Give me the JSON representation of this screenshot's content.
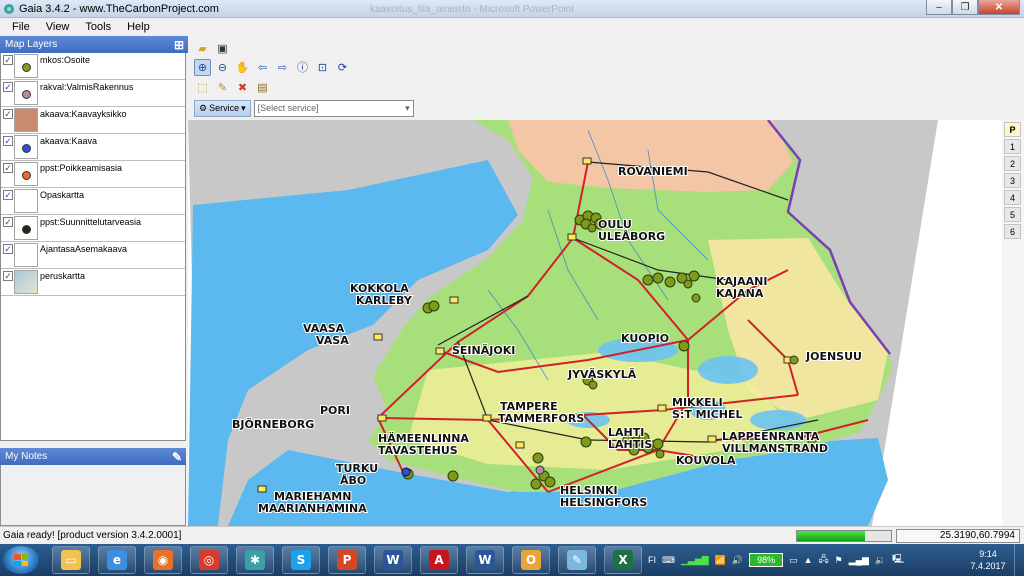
{
  "window": {
    "title": "Gaia 3.4.2 - www.TheCarbonProject.com",
    "background_title": "kaavoitus_tila_aineisto - Microsoft PowerPoint",
    "minimize": "–",
    "maximize": "❐",
    "close": "✕"
  },
  "menu": [
    "File",
    "View",
    "Tools",
    "Help"
  ],
  "map_layers": {
    "header": "Map Layers",
    "items": [
      {
        "label": "mkos:Osoite",
        "checked": true,
        "symbol": "dot",
        "color": "#8a9a1c"
      },
      {
        "label": "rakval:ValmisRakennus",
        "checked": true,
        "symbol": "dot",
        "color": "#b88aa0"
      },
      {
        "label": "akaava:Kaavayksikko",
        "checked": true,
        "symbol": "fill",
        "color": "#c98a72"
      },
      {
        "label": "akaava:Kaava",
        "checked": true,
        "symbol": "dot",
        "color": "#2f4fe0"
      },
      {
        "label": "ppst:Poikkeamisasia",
        "checked": true,
        "symbol": "dot",
        "color": "#e86a2c"
      },
      {
        "label": "Opaskartta",
        "checked": true,
        "symbol": "none",
        "color": "#ffffff"
      },
      {
        "label": "ppst:Suunnittelutarveasia",
        "checked": true,
        "symbol": "dot",
        "color": "#1e2a10"
      },
      {
        "label": "AjantasaAsemakaava",
        "checked": true,
        "symbol": "none",
        "color": "#ffffff"
      },
      {
        "label": "peruskartta",
        "checked": true,
        "symbol": "thumb",
        "color": "#a9c8de"
      }
    ]
  },
  "notes": {
    "header": "My Notes"
  },
  "toolbar": {
    "service_label": "Service",
    "service_placeholder": "[Select service]"
  },
  "map": {
    "places": [
      {
        "id": "rovaniemi",
        "text": "ROVANIEMI"
      },
      {
        "id": "oulu1",
        "text": "OULU"
      },
      {
        "id": "oulu2",
        "text": "ULEÅBORG"
      },
      {
        "id": "kajaani1",
        "text": "KAJAANI"
      },
      {
        "id": "kajaani2",
        "text": "KAJANA"
      },
      {
        "id": "kokkola1",
        "text": "KOKKOLA"
      },
      {
        "id": "kokkola2",
        "text": "KARLEBY"
      },
      {
        "id": "vaasa1",
        "text": "VAASA"
      },
      {
        "id": "vaasa2",
        "text": "VASA"
      },
      {
        "id": "seinajoki",
        "text": "SEINÄJOKI"
      },
      {
        "id": "kuopio",
        "text": "KUOPIO"
      },
      {
        "id": "joensuu",
        "text": "JOENSUU"
      },
      {
        "id": "jyvaskyla",
        "text": "JYVÄSKYLÄ"
      },
      {
        "id": "pori1",
        "text": "PORI"
      },
      {
        "id": "pori2",
        "text": "BJÖRNEBORG"
      },
      {
        "id": "tampere1",
        "text": "TAMPERE"
      },
      {
        "id": "tampere2",
        "text": "TAMMERFORS"
      },
      {
        "id": "mikkeli1",
        "text": "MIKKELI"
      },
      {
        "id": "mikkeli2",
        "text": "S:T MICHEL"
      },
      {
        "id": "hameenlinna1",
        "text": "HÄMEENLINNA"
      },
      {
        "id": "hameenlinna2",
        "text": "TAVASTEHUS"
      },
      {
        "id": "lahti1",
        "text": "LAHTI"
      },
      {
        "id": "lahti2",
        "text": "LAHTIS"
      },
      {
        "id": "lappeenranta1",
        "text": "LAPPEENRANTA"
      },
      {
        "id": "lappeenranta2",
        "text": "VILLMANSTRAND"
      },
      {
        "id": "kouvola",
        "text": "KOUVOLA"
      },
      {
        "id": "turku1",
        "text": "TURKU"
      },
      {
        "id": "turku2",
        "text": "ÅBO"
      },
      {
        "id": "helsinki1",
        "text": "HELSINKI"
      },
      {
        "id": "helsinki2",
        "text": "HELSINGFORS"
      },
      {
        "id": "mariehamn1",
        "text": "MARIEHAMN"
      },
      {
        "id": "mariehamn2",
        "text": "MAARIANHAMINA"
      }
    ],
    "pages": [
      "P",
      "1",
      "2",
      "3",
      "4",
      "5",
      "6"
    ]
  },
  "status": {
    "message": "Gaia ready! [product version 3.4.2.0001]",
    "progress_percent": 72,
    "coordinates": "25.3190,60.7994"
  },
  "taskbar": {
    "apps": [
      {
        "name": "explorer",
        "color": "#f2c14e",
        "glyph": "▭"
      },
      {
        "name": "ie",
        "color": "#3a8fe0",
        "glyph": "e"
      },
      {
        "name": "firefox",
        "color": "#e8702a",
        "glyph": "◉"
      },
      {
        "name": "chrome",
        "color": "#d83b2b",
        "glyph": "◎"
      },
      {
        "name": "gaia",
        "color": "#3aa0a8",
        "glyph": "✱"
      },
      {
        "name": "skype",
        "color": "#1aa3e8",
        "glyph": "S"
      },
      {
        "name": "powerpoint",
        "color": "#d24726",
        "glyph": "P"
      },
      {
        "name": "word",
        "color": "#2b5797",
        "glyph": "W"
      },
      {
        "name": "acrobat",
        "color": "#c4161c",
        "glyph": "A"
      },
      {
        "name": "word2",
        "color": "#2b5797",
        "glyph": "W"
      },
      {
        "name": "outlook",
        "color": "#e8a33a",
        "glyph": "O"
      },
      {
        "name": "paint",
        "color": "#7bb7e0",
        "glyph": "✎"
      },
      {
        "name": "excel",
        "color": "#1e7145",
        "glyph": "X"
      }
    ],
    "language": "FI",
    "battery": "98%",
    "time": "9:14",
    "date": "7.4.2017"
  }
}
